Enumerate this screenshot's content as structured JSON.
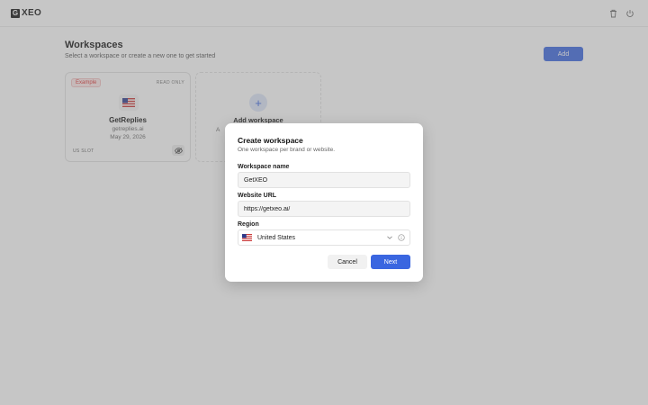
{
  "app": {
    "logo_mark": "G",
    "logo_text": "XEO"
  },
  "topbar": {
    "icons": [
      "trash-icon",
      "power-icon"
    ]
  },
  "page": {
    "title": "Workspaces",
    "subtitle": "Select a workspace or create a new one to get started",
    "add_label": "Add"
  },
  "workspace_card": {
    "badge": "Example",
    "access": "READ ONLY",
    "flag": "us-flag",
    "name": "GetReplies",
    "url": "getreplies.ai",
    "date": "May 29, 2026",
    "region_code": "US SLOT",
    "icon": "eye-off-icon"
  },
  "add_card": {
    "title": "Add workspace",
    "subtitle": "A"
  },
  "modal": {
    "title": "Create workspace",
    "subtitle": "One workspace per brand or website.",
    "name_label": "Workspace name",
    "name_value": "GetXEO",
    "url_label": "Website URL",
    "url_value": "https://getxeo.ai/",
    "region_label": "Region",
    "region_value": "United States",
    "cancel_label": "Cancel",
    "next_label": "Next"
  },
  "colors": {
    "accent": "#3a66e0",
    "badge_red": "#dd3333"
  }
}
